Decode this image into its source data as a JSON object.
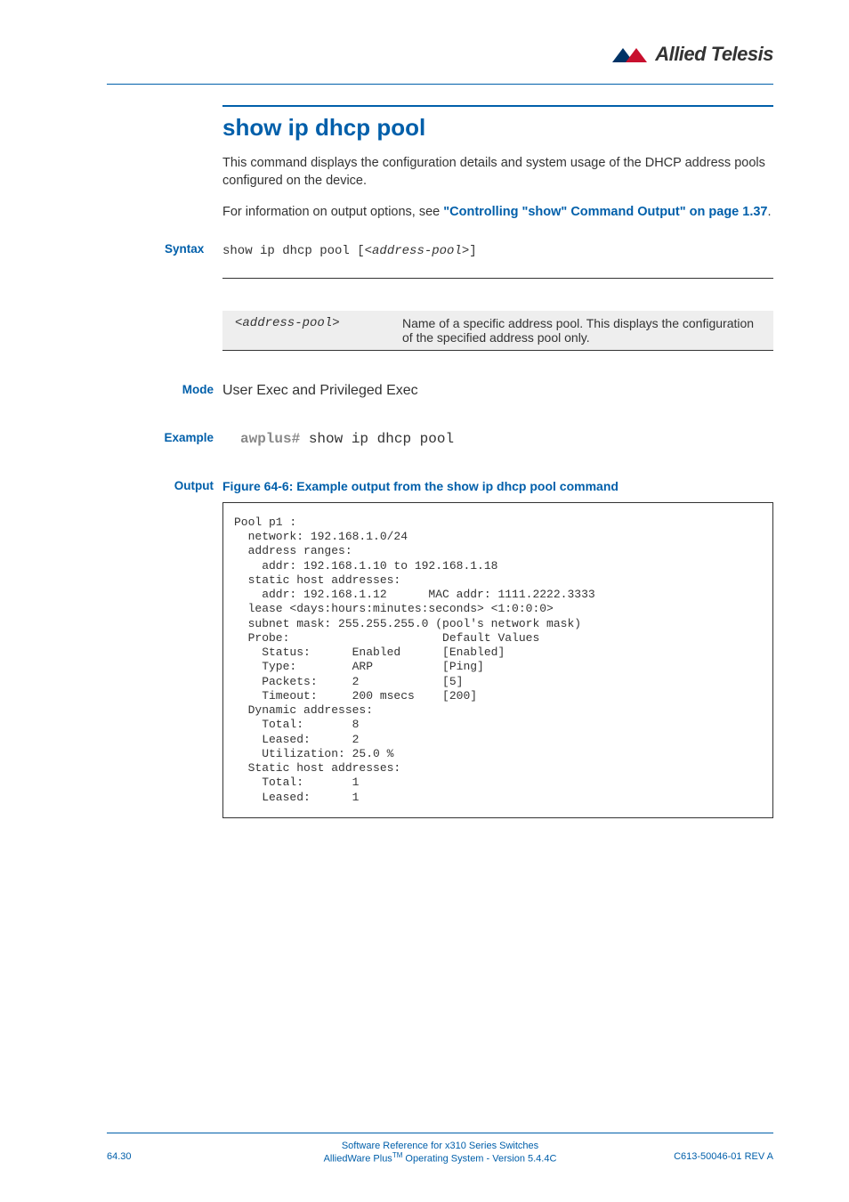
{
  "logo_text": "Allied Telesis",
  "title": "show ip dhcp pool",
  "intro": "This command displays the configuration details and system usage of the DHCP address pools configured on the device.",
  "xref_pre": "For information on output options, see ",
  "xref_link": "\"Controlling \"show\" Command Output\" on page 1.37",
  "xref_post": ".",
  "syntax_label": "Syntax",
  "syntax_text": "show ip dhcp pool [<",
  "syntax_italic": "address-pool",
  "syntax_text2": ">]",
  "param_name": "<address-pool>",
  "param_desc": "Name of a specific address pool. This displays the configuration of the specified address pool only.",
  "mode_label": "Mode",
  "mode_text": "User Exec and Privileged Exec",
  "example_label": "Example",
  "example_prompt": "awplus#",
  "example_cmd": " show ip dhcp pool",
  "output_label": "Output",
  "figure_caption": "Figure 64-6: Example output from the show ip dhcp pool command",
  "code": "Pool p1 :\n  network: 192.168.1.0/24\n  address ranges:\n    addr: 192.168.1.10 to 192.168.1.18\n  static host addresses:\n    addr: 192.168.1.12      MAC addr: 1111.2222.3333\n  lease <days:hours:minutes:seconds> <1:0:0:0>\n  subnet mask: 255.255.255.0 (pool's network mask)\n  Probe:                      Default Values\n    Status:      Enabled      [Enabled]\n    Type:        ARP          [Ping]\n    Packets:     2            [5]\n    Timeout:     200 msecs    [200]\n  Dynamic addresses:\n    Total:       8\n    Leased:      2\n    Utilization: 25.0 %\n  Static host addresses:\n    Total:       1\n    Leased:      1",
  "footer_line1": "Software Reference for x310 Series Switches",
  "footer_line2a": "AlliedWare Plus",
  "footer_line2b": " Operating System  - Version 5.4.4C",
  "footer_left": "64.30",
  "footer_right": "C613-50046-01 REV A"
}
